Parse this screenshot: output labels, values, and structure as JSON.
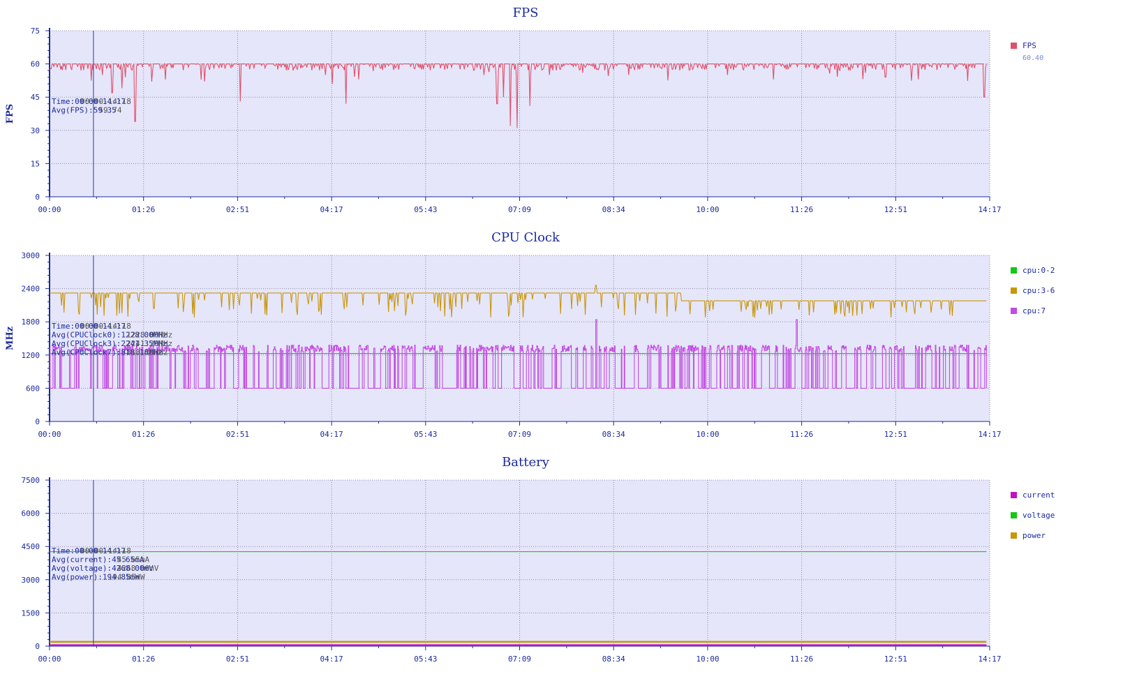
{
  "chart_data": [
    {
      "id": "fps",
      "type": "line",
      "title": "FPS",
      "ylabel": "FPS",
      "xlabel": "",
      "ylim": [
        0,
        75
      ],
      "yticks": [
        0,
        15,
        30,
        45,
        60,
        75
      ],
      "xlim_minutes": [
        0,
        14.283
      ],
      "xtick_labels": [
        "00:00",
        "01:26",
        "02:51",
        "04:17",
        "05:43",
        "07:09",
        "08:34",
        "10:00",
        "11:26",
        "12:51",
        "14:17"
      ],
      "grid": true,
      "cursor_time": "00:40",
      "annotation": {
        "lines": [
          "Time:00:00-14:17",
          "Avg(FPS):59.35"
        ],
        "overlay": [
          "Time:00:00-14:18",
          "Avg(FPS):59.74"
        ]
      },
      "legend": [
        {
          "name": "FPS",
          "color": "#e0506a",
          "value": "60.40"
        }
      ],
      "series": [
        {
          "name": "FPS",
          "color": "#e0506a",
          "baseline": 60,
          "noise": 1.5,
          "dips": [
            [
              0.8,
              55
            ],
            [
              0.95,
              47
            ],
            [
              1.1,
              49
            ],
            [
              1.3,
              34
            ],
            [
              1.55,
              52
            ],
            [
              2.3,
              53
            ],
            [
              2.9,
              43
            ],
            [
              4.3,
              51
            ],
            [
              4.5,
              42
            ],
            [
              4.7,
              53
            ],
            [
              6.6,
              55
            ],
            [
              6.8,
              42
            ],
            [
              6.9,
              45
            ],
            [
              7.0,
              32
            ],
            [
              7.1,
              31
            ],
            [
              7.3,
              41
            ],
            [
              7.6,
              55
            ],
            [
              8.1,
              56
            ],
            [
              8.8,
              55
            ],
            [
              10.3,
              55
            ],
            [
              11.0,
              53
            ],
            [
              12.4,
              56
            ],
            [
              12.7,
              54
            ],
            [
              13.2,
              53
            ],
            [
              14.2,
              45
            ]
          ]
        }
      ]
    },
    {
      "id": "cpu",
      "type": "line",
      "title": "CPU Clock",
      "ylabel": "MHz",
      "xlabel": "",
      "ylim": [
        0,
        3000
      ],
      "yticks": [
        0,
        600,
        1200,
        1800,
        2400,
        3000
      ],
      "xlim_minutes": [
        0,
        14.283
      ],
      "xtick_labels": [
        "00:00",
        "01:26",
        "02:51",
        "04:17",
        "05:43",
        "07:09",
        "08:34",
        "10:00",
        "11:26",
        "12:51",
        "14:17"
      ],
      "grid": true,
      "cursor_time": "00:40",
      "annotation": {
        "lines": [
          "Time:00:00-14:17",
          "Avg(CPUClock0):1228.00MHz",
          "Avg(CPUClock3):2241.35MHz",
          "Avg(CPUClock7):818.18MHz"
        ],
        "overlay": [
          "Time:00:00-14:18",
          "Avg(CPUClock0):1228.00MHz",
          "Avg(CPUClock3):2241.20MHz",
          "Avg(CPUClock7):818.18MHz"
        ]
      },
      "legend": [
        {
          "name": "cpu:0-2",
          "color": "#16c716"
        },
        {
          "name": "cpu:3-6",
          "color": "#c8960a"
        },
        {
          "name": "cpu:7",
          "color": "#c24ce0"
        }
      ],
      "series": [
        {
          "name": "cpu:0-2",
          "color": "#16c716",
          "constant": 1228
        },
        {
          "name": "cpu:3-6",
          "color": "#c8960a",
          "segments": [
            [
              0,
              9.6,
              2320
            ],
            [
              9.6,
              14.25,
              2180
            ]
          ],
          "low": 1950,
          "spike": [
            8.3,
            2460
          ]
        },
        {
          "name": "cpu:7",
          "color": "#c24ce0",
          "low": 600,
          "high": 1380,
          "spike": [
            8.3,
            1840
          ],
          "spike2": [
            11.35,
            1840
          ]
        }
      ]
    },
    {
      "id": "battery",
      "type": "line",
      "title": "Battery",
      "ylabel": "",
      "xlabel": "",
      "ylim": [
        0,
        7500
      ],
      "yticks": [
        0,
        1500,
        3000,
        4500,
        6000,
        7500
      ],
      "xlim_minutes": [
        0,
        14.283
      ],
      "xtick_labels": [
        "00:00",
        "01:26",
        "02:51",
        "04:17",
        "05:43",
        "07:09",
        "08:34",
        "10:00",
        "11:26",
        "12:51",
        "14:17"
      ],
      "grid": true,
      "cursor_time": "00:40",
      "annotation": {
        "lines": [
          "Time:00:00-14:17",
          "Avg(current):45.65mA",
          "Avg(voltage):4268.00mV",
          "Avg(power):194.85mW"
        ],
        "overlay": [
          "Time:00:00-14:18",
          "Avg(current):45.65mA",
          "Avg(voltage):4268.00mV",
          "Avg(power):194.85mW"
        ]
      },
      "legend": [
        {
          "name": "current",
          "color": "#c410c4"
        },
        {
          "name": "voltage",
          "color": "#16c716"
        },
        {
          "name": "power",
          "color": "#c8960a"
        }
      ],
      "series": [
        {
          "name": "current",
          "color": "#c410c4",
          "constant": 45
        },
        {
          "name": "voltage",
          "color": "#16c716",
          "constant": 4268
        },
        {
          "name": "power",
          "color": "#c8960a",
          "constant": 195
        }
      ]
    }
  ]
}
